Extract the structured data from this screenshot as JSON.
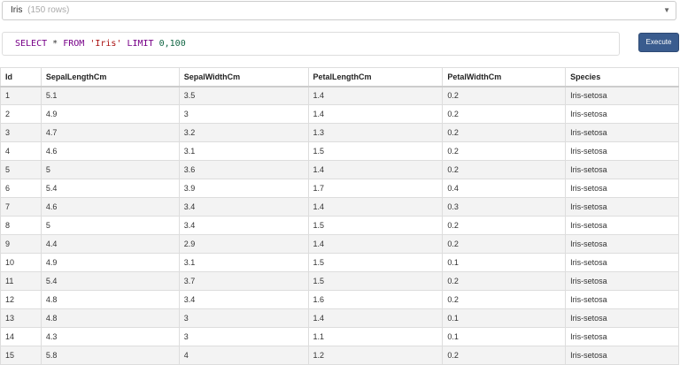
{
  "table_select": {
    "name": "Iris",
    "rows_label": "(150 rows)"
  },
  "query": {
    "select": "SELECT",
    "star": " * ",
    "from": "FROM",
    "table": "'Iris'",
    "limit": "LIMIT",
    "range": "0,100"
  },
  "execute_label": "Execute",
  "columns": [
    "Id",
    "SepalLengthCm",
    "SepalWidthCm",
    "PetalLengthCm",
    "PetalWidthCm",
    "Species"
  ],
  "rows": [
    [
      "1",
      "5.1",
      "3.5",
      "1.4",
      "0.2",
      "Iris-setosa"
    ],
    [
      "2",
      "4.9",
      "3",
      "1.4",
      "0.2",
      "Iris-setosa"
    ],
    [
      "3",
      "4.7",
      "3.2",
      "1.3",
      "0.2",
      "Iris-setosa"
    ],
    [
      "4",
      "4.6",
      "3.1",
      "1.5",
      "0.2",
      "Iris-setosa"
    ],
    [
      "5",
      "5",
      "3.6",
      "1.4",
      "0.2",
      "Iris-setosa"
    ],
    [
      "6",
      "5.4",
      "3.9",
      "1.7",
      "0.4",
      "Iris-setosa"
    ],
    [
      "7",
      "4.6",
      "3.4",
      "1.4",
      "0.3",
      "Iris-setosa"
    ],
    [
      "8",
      "5",
      "3.4",
      "1.5",
      "0.2",
      "Iris-setosa"
    ],
    [
      "9",
      "4.4",
      "2.9",
      "1.4",
      "0.2",
      "Iris-setosa"
    ],
    [
      "10",
      "4.9",
      "3.1",
      "1.5",
      "0.1",
      "Iris-setosa"
    ],
    [
      "11",
      "5.4",
      "3.7",
      "1.5",
      "0.2",
      "Iris-setosa"
    ],
    [
      "12",
      "4.8",
      "3.4",
      "1.6",
      "0.2",
      "Iris-setosa"
    ],
    [
      "13",
      "4.8",
      "3",
      "1.4",
      "0.1",
      "Iris-setosa"
    ],
    [
      "14",
      "4.3",
      "3",
      "1.1",
      "0.1",
      "Iris-setosa"
    ],
    [
      "15",
      "5.8",
      "4",
      "1.2",
      "0.2",
      "Iris-setosa"
    ]
  ]
}
